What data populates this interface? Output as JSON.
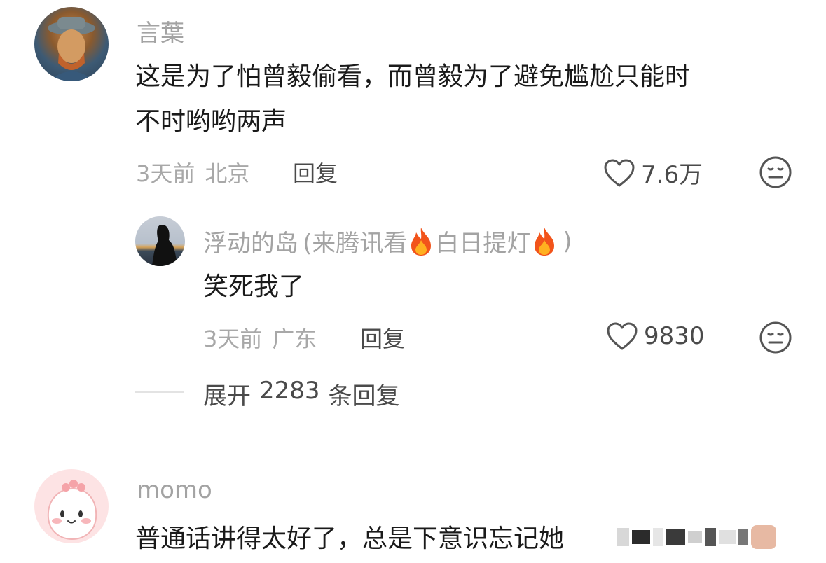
{
  "comments": [
    {
      "username": "言葉",
      "text_line1": "这是为了怕曾毅偷看，而曾毅为了避免尴尬只能时",
      "text_line2": "不时哟哟两声",
      "time": "3天前",
      "location": "北京",
      "reply_label": "回复",
      "likes": "7.6万"
    },
    {
      "username": "momo",
      "text_line1": "普通话讲得太好了，总是下意识忘记她"
    }
  ],
  "reply": {
    "username": "浮动的岛",
    "tag_open": "(来腾讯看",
    "tag_middle": "白日提灯",
    "tag_close": ")",
    "text": "笑死我了",
    "time": "3天前",
    "location": "广东",
    "reply_label": "回复",
    "likes": "9830"
  },
  "expand": {
    "label_prefix": "展开",
    "count": "2283",
    "label_suffix": "条回复"
  },
  "colors": {
    "username": "#a3a3a3",
    "text": "#1a1a1a",
    "meta": "#a8a8a8",
    "action": "#4a4a4a"
  }
}
